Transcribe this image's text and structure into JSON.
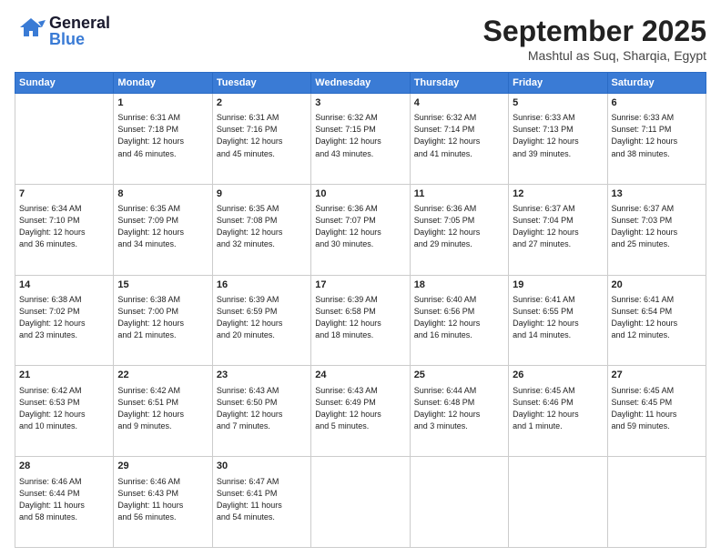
{
  "header": {
    "logo_general": "General",
    "logo_blue": "Blue",
    "month": "September 2025",
    "location": "Mashtul as Suq, Sharqia, Egypt"
  },
  "days_of_week": [
    "Sunday",
    "Monday",
    "Tuesday",
    "Wednesday",
    "Thursday",
    "Friday",
    "Saturday"
  ],
  "weeks": [
    [
      {
        "day": "",
        "content": ""
      },
      {
        "day": "1",
        "content": "Sunrise: 6:31 AM\nSunset: 7:18 PM\nDaylight: 12 hours\nand 46 minutes."
      },
      {
        "day": "2",
        "content": "Sunrise: 6:31 AM\nSunset: 7:16 PM\nDaylight: 12 hours\nand 45 minutes."
      },
      {
        "day": "3",
        "content": "Sunrise: 6:32 AM\nSunset: 7:15 PM\nDaylight: 12 hours\nand 43 minutes."
      },
      {
        "day": "4",
        "content": "Sunrise: 6:32 AM\nSunset: 7:14 PM\nDaylight: 12 hours\nand 41 minutes."
      },
      {
        "day": "5",
        "content": "Sunrise: 6:33 AM\nSunset: 7:13 PM\nDaylight: 12 hours\nand 39 minutes."
      },
      {
        "day": "6",
        "content": "Sunrise: 6:33 AM\nSunset: 7:11 PM\nDaylight: 12 hours\nand 38 minutes."
      }
    ],
    [
      {
        "day": "7",
        "content": "Sunrise: 6:34 AM\nSunset: 7:10 PM\nDaylight: 12 hours\nand 36 minutes."
      },
      {
        "day": "8",
        "content": "Sunrise: 6:35 AM\nSunset: 7:09 PM\nDaylight: 12 hours\nand 34 minutes."
      },
      {
        "day": "9",
        "content": "Sunrise: 6:35 AM\nSunset: 7:08 PM\nDaylight: 12 hours\nand 32 minutes."
      },
      {
        "day": "10",
        "content": "Sunrise: 6:36 AM\nSunset: 7:07 PM\nDaylight: 12 hours\nand 30 minutes."
      },
      {
        "day": "11",
        "content": "Sunrise: 6:36 AM\nSunset: 7:05 PM\nDaylight: 12 hours\nand 29 minutes."
      },
      {
        "day": "12",
        "content": "Sunrise: 6:37 AM\nSunset: 7:04 PM\nDaylight: 12 hours\nand 27 minutes."
      },
      {
        "day": "13",
        "content": "Sunrise: 6:37 AM\nSunset: 7:03 PM\nDaylight: 12 hours\nand 25 minutes."
      }
    ],
    [
      {
        "day": "14",
        "content": "Sunrise: 6:38 AM\nSunset: 7:02 PM\nDaylight: 12 hours\nand 23 minutes."
      },
      {
        "day": "15",
        "content": "Sunrise: 6:38 AM\nSunset: 7:00 PM\nDaylight: 12 hours\nand 21 minutes."
      },
      {
        "day": "16",
        "content": "Sunrise: 6:39 AM\nSunset: 6:59 PM\nDaylight: 12 hours\nand 20 minutes."
      },
      {
        "day": "17",
        "content": "Sunrise: 6:39 AM\nSunset: 6:58 PM\nDaylight: 12 hours\nand 18 minutes."
      },
      {
        "day": "18",
        "content": "Sunrise: 6:40 AM\nSunset: 6:56 PM\nDaylight: 12 hours\nand 16 minutes."
      },
      {
        "day": "19",
        "content": "Sunrise: 6:41 AM\nSunset: 6:55 PM\nDaylight: 12 hours\nand 14 minutes."
      },
      {
        "day": "20",
        "content": "Sunrise: 6:41 AM\nSunset: 6:54 PM\nDaylight: 12 hours\nand 12 minutes."
      }
    ],
    [
      {
        "day": "21",
        "content": "Sunrise: 6:42 AM\nSunset: 6:53 PM\nDaylight: 12 hours\nand 10 minutes."
      },
      {
        "day": "22",
        "content": "Sunrise: 6:42 AM\nSunset: 6:51 PM\nDaylight: 12 hours\nand 9 minutes."
      },
      {
        "day": "23",
        "content": "Sunrise: 6:43 AM\nSunset: 6:50 PM\nDaylight: 12 hours\nand 7 minutes."
      },
      {
        "day": "24",
        "content": "Sunrise: 6:43 AM\nSunset: 6:49 PM\nDaylight: 12 hours\nand 5 minutes."
      },
      {
        "day": "25",
        "content": "Sunrise: 6:44 AM\nSunset: 6:48 PM\nDaylight: 12 hours\nand 3 minutes."
      },
      {
        "day": "26",
        "content": "Sunrise: 6:45 AM\nSunset: 6:46 PM\nDaylight: 12 hours\nand 1 minute."
      },
      {
        "day": "27",
        "content": "Sunrise: 6:45 AM\nSunset: 6:45 PM\nDaylight: 11 hours\nand 59 minutes."
      }
    ],
    [
      {
        "day": "28",
        "content": "Sunrise: 6:46 AM\nSunset: 6:44 PM\nDaylight: 11 hours\nand 58 minutes."
      },
      {
        "day": "29",
        "content": "Sunrise: 6:46 AM\nSunset: 6:43 PM\nDaylight: 11 hours\nand 56 minutes."
      },
      {
        "day": "30",
        "content": "Sunrise: 6:47 AM\nSunset: 6:41 PM\nDaylight: 11 hours\nand 54 minutes."
      },
      {
        "day": "",
        "content": ""
      },
      {
        "day": "",
        "content": ""
      },
      {
        "day": "",
        "content": ""
      },
      {
        "day": "",
        "content": ""
      }
    ]
  ]
}
